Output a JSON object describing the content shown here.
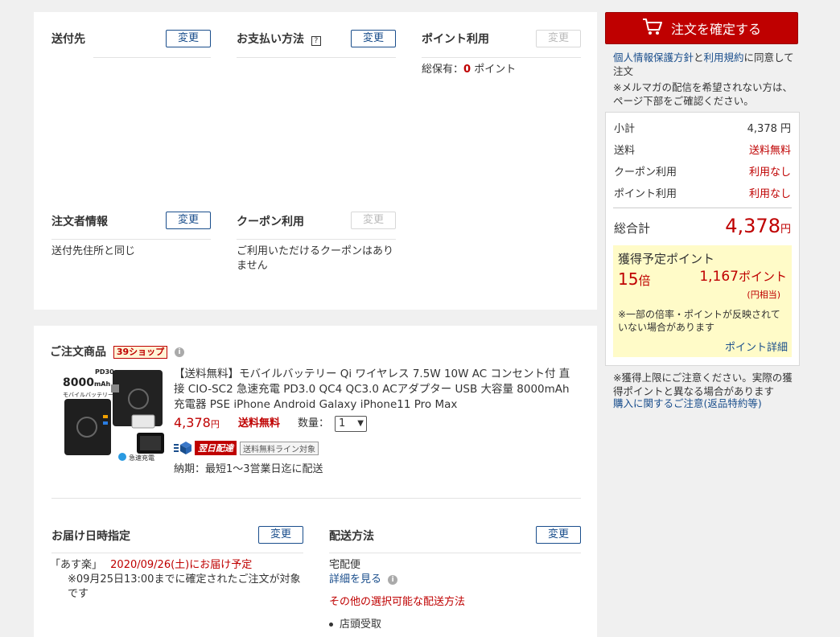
{
  "shipping": {
    "title": "送付先",
    "change": "変更"
  },
  "payment": {
    "title": "お支払い方法",
    "help": "?",
    "change": "変更"
  },
  "points_use": {
    "title": "ポイント利用",
    "change": "変更",
    "held_label": "総保有：",
    "held_value": "0",
    "held_unit": " ポイント"
  },
  "orderer": {
    "title": "注文者情報",
    "change": "変更",
    "text": "送付先住所と同じ"
  },
  "coupon": {
    "title": "クーポン利用",
    "change": "変更",
    "text": "ご利用いただけるクーポンはありません"
  },
  "items": {
    "title": "ご注文商品",
    "shop_badge": "39ショップ",
    "product": {
      "name": "【送料無料】モバイルバッテリー Qi ワイヤレス 7.5W 10W AC コンセント付 直接 CIO-SC2 急速充電 PD3.0 QC4 QC3.0 ACアダプター USB 大容量 8000mAh 充電器 PSE iPhone Android Galaxy iPhone11 Pro Max",
      "price": "4,378",
      "price_unit": "円",
      "shipping_free": "送料無料",
      "qty_label": "数量：",
      "qty_value": "1",
      "next_day_badge": "翌日配達",
      "free_line_badge": "送料無料ライン対象",
      "delivery_time": "納期：最短1～3営業日迄に配送",
      "img_text_pd": "PD30",
      "img_text_capacity": "8000",
      "img_text_mah": "mAh",
      "img_text_sub": "モバイルバッテリー",
      "img_text_qi": "急速充電"
    }
  },
  "delivery_date": {
    "title": "お届け日時指定",
    "change": "変更",
    "asuraku": "「あす楽」",
    "date_text": "2020/09/26(土)にお届け予定",
    "note": "※09月25日13:00までに確定されたご注文が対象です"
  },
  "delivery_method": {
    "title": "配送方法",
    "change": "変更",
    "method": "宅配便",
    "detail_link": "詳細を見る",
    "other_link": "その他の選択可能な配送方法",
    "option1": "店頭受取"
  },
  "confirm": {
    "button_label": "注文を確定する",
    "agree_link1": "個人情報保護方針",
    "agree_and": "と",
    "agree_link2": "利用規約",
    "agree_rest": "に同意して注文",
    "mailmag_note": "※メルマガの配信を希望されない方は、ページ下部をご確認ください。"
  },
  "summary": {
    "subtotal_label": "小計",
    "subtotal_value": "4,378 円",
    "shipping_label": "送料",
    "shipping_value": "送料無料",
    "coupon_label": "クーポン利用",
    "coupon_value": "利用なし",
    "points_label": "ポイント利用",
    "points_value": "利用なし",
    "total_label": "総合計",
    "total_value": "4,378",
    "total_unit": "円"
  },
  "points_earn": {
    "title": "獲得予定ポイント",
    "multiplier": "15",
    "multiplier_unit": "倍",
    "points": "1,167",
    "points_unit": "ポイント",
    "yen_equiv": "(円相当)",
    "note": "※一部の倍率・ポイントが反映されていない場合があります",
    "detail_link": "ポイント詳細"
  },
  "footer_note": {
    "text": "※獲得上限にご注意ください。実際の獲得ポイントと異なる場合があります",
    "link": "購入に関するご注意(返品特約等)"
  },
  "colors": {
    "accent_red": "#bf0000",
    "link_blue": "#1a4e8c",
    "points_bg": "#fffbc8"
  }
}
